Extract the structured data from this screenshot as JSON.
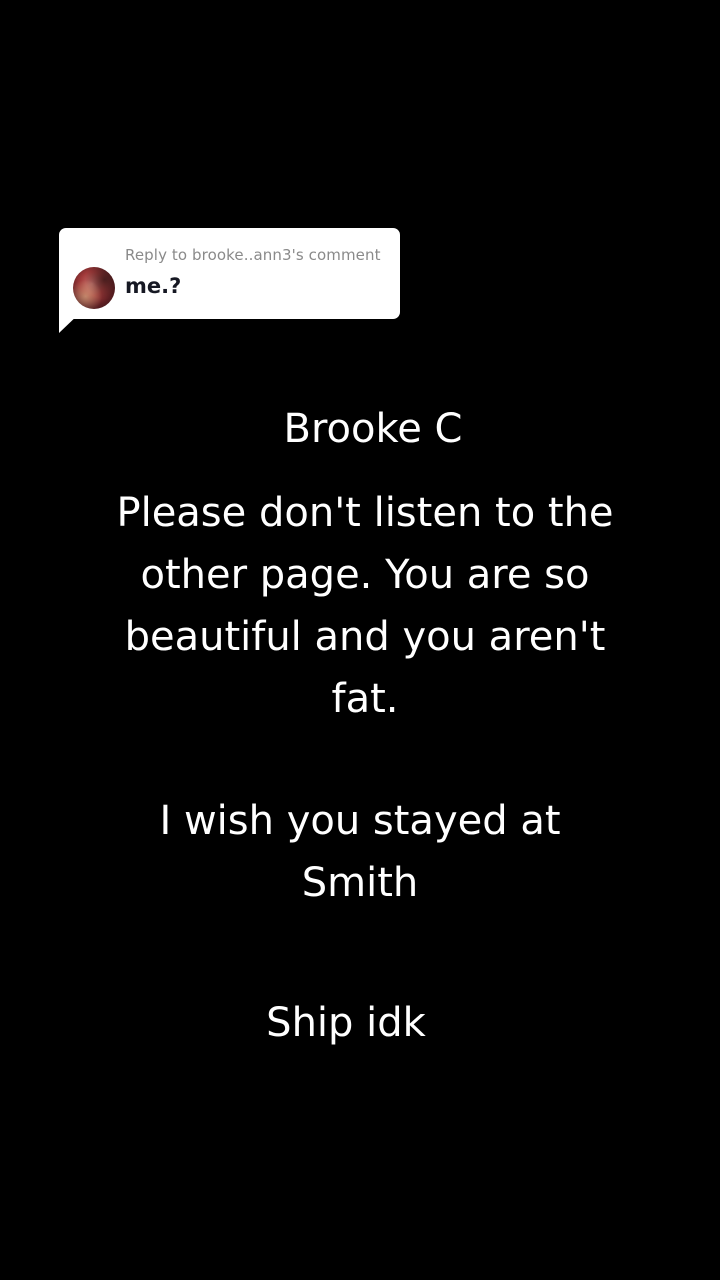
{
  "reply_sticker": {
    "header": "Reply to brooke..ann3's comment",
    "comment": "me.?",
    "avatar_icon": "user-avatar-photo"
  },
  "caption": {
    "name": "Brooke C",
    "message_lines": [
      "Please don't listen to the",
      "other page. You are so",
      "beautiful and you aren't",
      "fat."
    ],
    "wish_lines": [
      "I wish you stayed at",
      "Smith"
    ],
    "ship": "Ship idk"
  },
  "colors": {
    "background": "#000000",
    "text": "#ffffff",
    "sticker_bg": "#ffffff",
    "sticker_header": "#8a8a8a",
    "sticker_text": "#161823"
  }
}
